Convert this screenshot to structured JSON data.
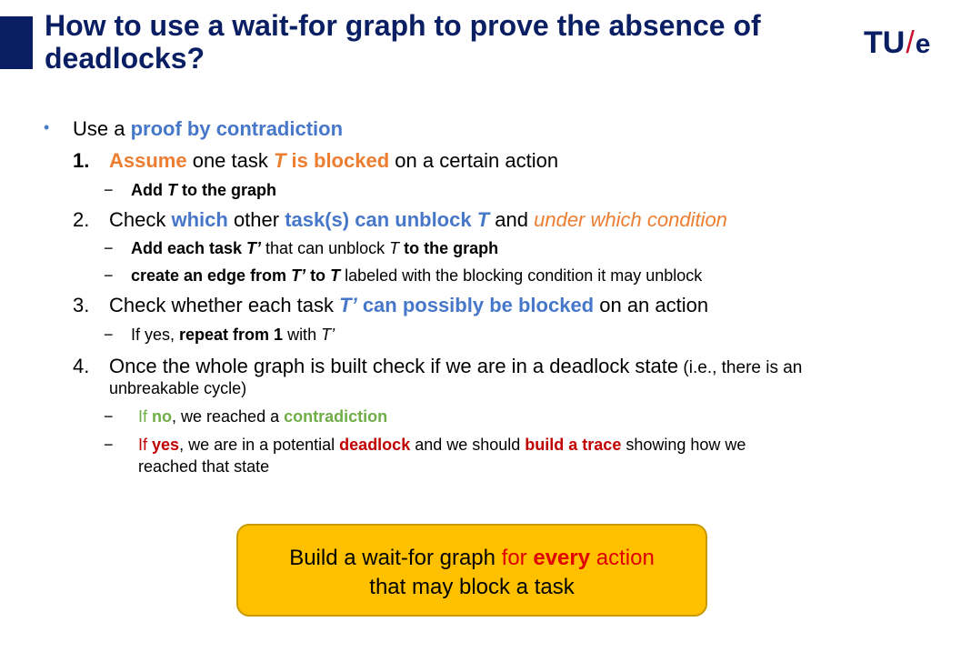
{
  "slide": {
    "title": "How to use a wait-for graph to prove the absence of deadlocks?",
    "logo": {
      "t": "TU",
      "slash": "/",
      "e": "e"
    }
  },
  "bullet": {
    "marker": "•",
    "prefix": "Use a ",
    "highlight": "proof by contradiction"
  },
  "step1": {
    "num": "1.",
    "assume": "Assume",
    "mid": " one task ",
    "t": "T",
    "blocked": " is blocked",
    "rest": " on a certain action",
    "sub1": {
      "dash": "−",
      "a": "Add ",
      "t": "T",
      "b": " to the graph"
    }
  },
  "step2": {
    "num": "2.",
    "a": "Check ",
    "which": "which",
    "b": " other ",
    "tasks": "task(s) can unblock ",
    "t": "T",
    "c": " and ",
    "cond": "under which condition",
    "sub1": {
      "dash": "−",
      "a": "Add each task ",
      "tp": "T’",
      "b": " that can unblock ",
      "t": "T",
      "c": " to the graph"
    },
    "sub2": {
      "dash": "−",
      "a": "create an edge from ",
      "tp": "T’",
      "b": " to ",
      "t": "T",
      "c": " labeled with the blocking condition it may unblock"
    }
  },
  "step3": {
    "num": "3.",
    "a": "Check whether each task ",
    "tp": "T’",
    "b": " can possibly be blocked",
    "c": " on an action",
    "sub1": {
      "dash": "−",
      "a": "If yes, ",
      "b": "repeat from 1",
      "c": " with ",
      "tp": "T’"
    }
  },
  "step4": {
    "num": "4.",
    "a": "Once the whole graph is built check if we are in a deadlock state",
    "b": " (i.e., there is an",
    "c": "unbreakable cycle)",
    "sub1": {
      "dash": "−",
      "a": "If ",
      "no": "no",
      "b": ", we reached a ",
      "contra": "contradiction"
    },
    "sub2": {
      "dash": "−",
      "a": "If ",
      "yes": "yes",
      "b": ", we are in a potential ",
      "deadlock": "deadlock",
      "c": " and we should ",
      "trace": "build a trace",
      "d": " showing how we",
      "e": "reached that state"
    }
  },
  "callout": {
    "a": "Build a wait-for graph ",
    "for": "for ",
    "every": "every",
    "action": " action",
    "line2": "that may block a task"
  }
}
